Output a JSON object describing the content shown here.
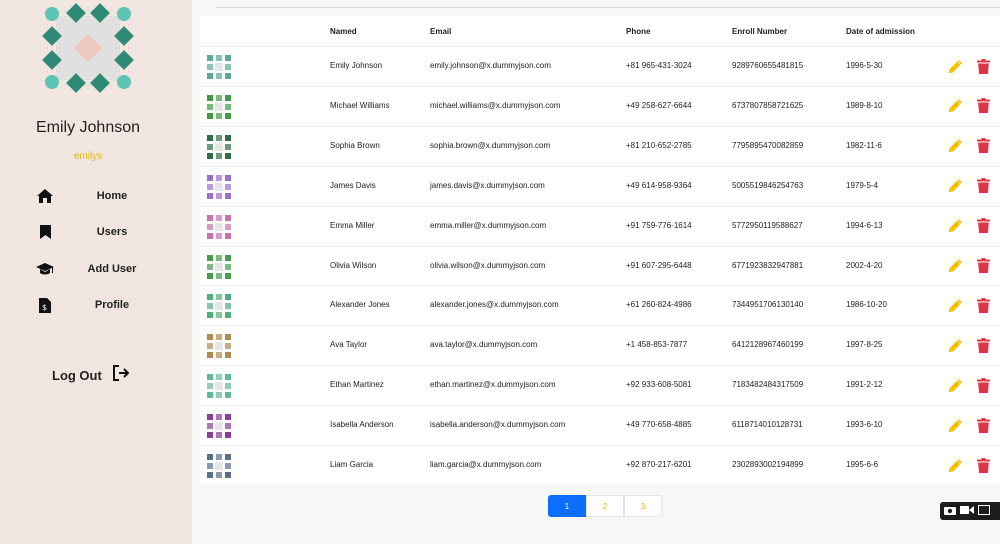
{
  "sidebar": {
    "profile_name": "Emily Johnson",
    "username": "emilys",
    "nav": [
      {
        "label": "Home",
        "icon": "home-icon"
      },
      {
        "label": "Users",
        "icon": "bookmark-icon"
      },
      {
        "label": "Add User",
        "icon": "graduation-cap-icon"
      },
      {
        "label": "Profile",
        "icon": "document-dollar-icon"
      }
    ],
    "logout_label": "Log Out"
  },
  "table": {
    "headers": {
      "name": "Named",
      "email": "Email",
      "phone": "Phone",
      "enroll": "Enroll Number",
      "date": "Date of admission"
    },
    "rows": [
      {
        "name": "Emily Johnson",
        "email": "emily.johnson@x.dummyjson.com",
        "phone": "+81 965-431-3024",
        "enroll": "9289760655481815",
        "date": "1996-5-30",
        "avatar_color": "#5aa89a"
      },
      {
        "name": "Michael Williams",
        "email": "michael.williams@x.dummyjson.com",
        "phone": "+49 258-627-6644",
        "enroll": "6737807858721625",
        "date": "1989-8-10",
        "avatar_color": "#3f9b46"
      },
      {
        "name": "Sophia Brown",
        "email": "sophia.brown@x.dummyjson.com",
        "phone": "+81 210-652-2785",
        "enroll": "7795895470082859",
        "date": "1982-11-6",
        "avatar_color": "#2f6d45"
      },
      {
        "name": "James Davis",
        "email": "james.davis@x.dummyjson.com",
        "phone": "+49 614-958-9364",
        "enroll": "5005519846254763",
        "date": "1979-5-4",
        "avatar_color": "#9b6fd0"
      },
      {
        "name": "Emma Miller",
        "email": "emma.miller@x.dummyjson.com",
        "phone": "+91 759-776-1614",
        "enroll": "5772950119588627",
        "date": "1994-6-13",
        "avatar_color": "#c86fb0"
      },
      {
        "name": "Olivia Wilson",
        "email": "olivia.wilson@x.dummyjson.com",
        "phone": "+91 607-295-6448",
        "enroll": "6771923832947881",
        "date": "2002-4-20",
        "avatar_color": "#4a9a4f"
      },
      {
        "name": "Alexander Jones",
        "email": "alexander.jones@x.dummyjson.com",
        "phone": "+61 260-824-4986",
        "enroll": "7344951706130140",
        "date": "1986-10-20",
        "avatar_color": "#4fb07a"
      },
      {
        "name": "Ava Taylor",
        "email": "ava.taylor@x.dummyjson.com",
        "phone": "+1 458-853-7877",
        "enroll": "6412128967460199",
        "date": "1997-8-25",
        "avatar_color": "#b08a4a"
      },
      {
        "name": "Ethan Martinez",
        "email": "ethan.martinez@x.dummyjson.com",
        "phone": "+92 933-608-5081",
        "enroll": "7183482484317509",
        "date": "1991-2-12",
        "avatar_color": "#5fb89a"
      },
      {
        "name": "Isabella Anderson",
        "email": "isabella.anderson@x.dummyjson.com",
        "phone": "+49 770-658-4885",
        "enroll": "6118714010128731",
        "date": "1993-6-10",
        "avatar_color": "#8a3f9b"
      },
      {
        "name": "Liam Garcia",
        "email": "liam.garcia@x.dummyjson.com",
        "phone": "+92 870-217-6201",
        "enroll": "2302893002194899",
        "date": "1995-6-6",
        "avatar_color": "#5a6f8a"
      }
    ]
  },
  "pagination": {
    "pages": [
      "1",
      "2",
      "3"
    ],
    "active": "1"
  },
  "colors": {
    "edit": "#f2c200",
    "delete": "#dc3545",
    "accent": "#0d6efd",
    "sidebar_bg": "#f1e6df",
    "username": "#e6b800"
  },
  "icons": {
    "edit": "pencil-icon",
    "delete": "trash-icon",
    "logout": "logout-icon"
  }
}
